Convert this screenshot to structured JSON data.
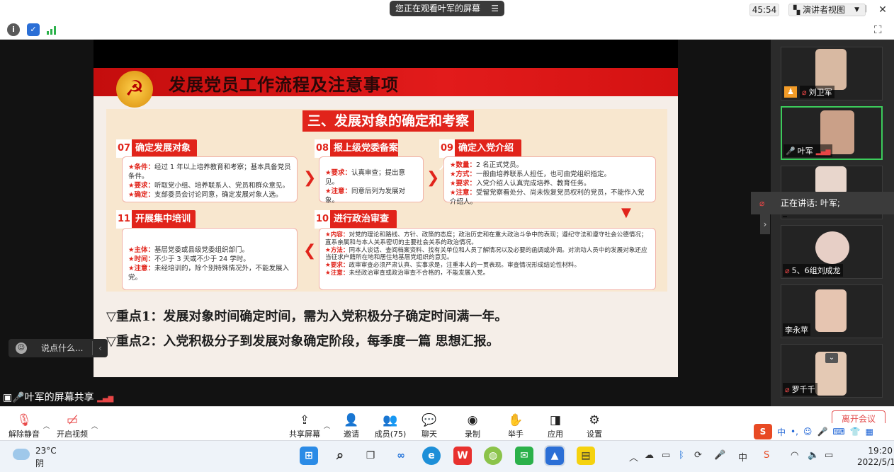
{
  "window": {
    "title": "您正在观看叶军的屏幕"
  },
  "infobar": {
    "timer": "45:54",
    "view_mode": "演讲者视图"
  },
  "slide": {
    "title": "发展党员工作流程及注意事项",
    "section": "三、发展对象的确定和考察",
    "steps": [
      {
        "num": "07",
        "title": "确定发展对象",
        "lines": [
          {
            "k": "★条件：",
            "v": "经过 1 年以上培养教育和考察；基本具备党员条件。"
          },
          {
            "k": "★要求：",
            "v": "听取党小组、培养联系人、党员和群众意见。"
          },
          {
            "k": "★确定：",
            "v": "支部委员会讨论同意，确定发展对象人选。"
          }
        ]
      },
      {
        "num": "08",
        "title": "报上级党委备案",
        "lines": [
          {
            "k": "★要求：",
            "v": "认真审查；提出意见。"
          },
          {
            "k": "★注意：",
            "v": "同意后列为发展对象。"
          }
        ]
      },
      {
        "num": "09",
        "title": "确定入党介绍人",
        "lines": [
          {
            "k": "★数量：",
            "v": "2 名正式党员。"
          },
          {
            "k": "★方式：",
            "v": "一般由培养联系人担任，也可由党组织指定。"
          },
          {
            "k": "★要求：",
            "v": "入党介绍人认真完成培养、教育任务。"
          },
          {
            "k": "★注意：",
            "v": "受留党察看处分、尚未恢复党员权利的党员，不能作入党介绍人。"
          }
        ]
      },
      {
        "num": "11",
        "title": "开展集中培训",
        "lines": [
          {
            "k": "★主体：",
            "v": "基层党委或县级党委组织部门。"
          },
          {
            "k": "★时间：",
            "v": "不少于 3 天或不少于 24 学时。"
          },
          {
            "k": "★注意：",
            "v": "未经培训的，除个别特殊情况外，不能发展入党。"
          }
        ]
      },
      {
        "num": "10",
        "title": "进行政治审查",
        "lines": [
          {
            "k": "★内容：",
            "v": "对党的理论和路线、方针、政策的态度；政治历史和在重大政治斗争中的表现；遵纪守法和遵守社会公德情况；直系亲属和与本人关系密切的主要社会关系的政治情况。"
          },
          {
            "k": "★方法：",
            "v": "同本人谈话、查阅档案资料、找有关单位和人员了解情况以及必要的函调或外调。对流动人员中的发展对象还应当征求户籍所在地和居住地基层党组织的意见。"
          },
          {
            "k": "★要求：",
            "v": "政审审查必须严肃认真、实事求是，注重本人的一贯表现。审查情况形成结论性材料。"
          },
          {
            "k": "★注意：",
            "v": "未经政治审查或政治审查不合格的，不能发展入党。"
          }
        ]
      }
    ],
    "key1": "▽重点1：发展对象时间确定时间，需为入党积极分子确定时间满一年。",
    "key2": "▽重点2：入党积极分子到发展对象确定阶段，每季度一篇 思想汇报。"
  },
  "chat": {
    "placeholder": "说点什么..."
  },
  "share_label": "叶军的屏幕共享",
  "participants": [
    {
      "name": "刘卫军"
    },
    {
      "name": "叶军"
    },
    {
      "name": ""
    },
    {
      "name": "5、6组刘成龙"
    },
    {
      "name": "李永苹"
    },
    {
      "name": "罗千千"
    }
  ],
  "speaking": "正在讲话: 叶军;",
  "toolbar": {
    "unmute": "解除静音",
    "start_video": "开启视频",
    "share": "共享屏幕",
    "invite": "邀请",
    "members": "成员(75)",
    "chat": "聊天",
    "record": "录制",
    "raise_hand": "举手",
    "apps": "应用",
    "settings": "设置",
    "leave": "离开会议"
  },
  "ime": {
    "lang": "中"
  },
  "taskbar": {
    "temp": "23°C",
    "weather": "阴",
    "tray_lang": "中",
    "time": "19:20",
    "date": "2022/5/19"
  },
  "colors": {
    "accent": "#e1241b",
    "active_speaker": "#3ccb5b",
    "stage": "#1b1b1b"
  }
}
